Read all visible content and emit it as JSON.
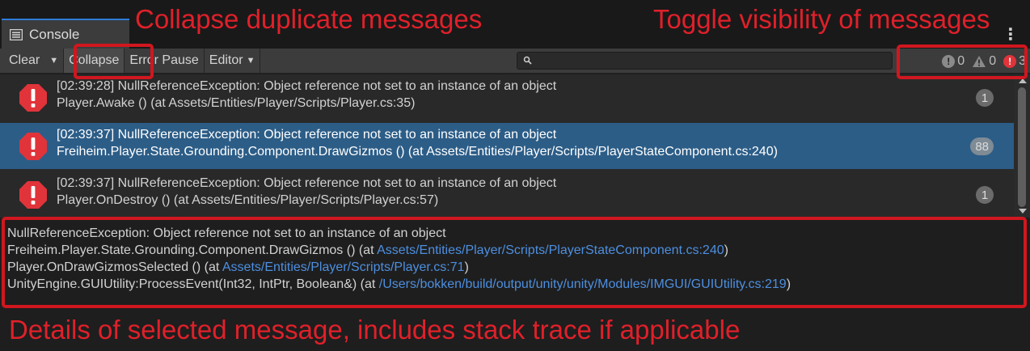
{
  "window": {
    "tab_label": "Console",
    "tab_icon": "console-list-icon",
    "menu_icon": "kebab-menu-icon",
    "accent": "#2f7cd6"
  },
  "toolbar": {
    "clear_label": "Clear",
    "collapse_label": "Collapse",
    "error_pause_label": "Error Pause",
    "editor_label": "Editor",
    "search_placeholder": "",
    "counters": {
      "info": "0",
      "warning": "0",
      "error": "3"
    }
  },
  "messages": [
    {
      "line1": "[02:39:28] NullReferenceException: Object reference not set to an instance of an object",
      "line2": "Player.Awake () (at Assets/Entities/Player/Scripts/Player.cs:35)",
      "count": "1",
      "selected": false
    },
    {
      "line1": "[02:39:37] NullReferenceException: Object reference not set to an instance of an object",
      "line2": "Freiheim.Player.State.Grounding.Component.DrawGizmos () (at Assets/Entities/Player/Scripts/PlayerStateComponent.cs:240)",
      "count": "88",
      "selected": true
    },
    {
      "line1": "[02:39:37] NullReferenceException: Object reference not set to an instance of an object",
      "line2": "Player.OnDestroy () (at Assets/Entities/Player/Scripts/Player.cs:57)",
      "count": "1",
      "selected": false
    }
  ],
  "details": {
    "line1": "NullReferenceException: Object reference not set to an instance of an object",
    "line2_prefix": "Freiheim.Player.State.Grounding.Component.DrawGizmos () (at ",
    "line2_link": "Assets/Entities/Player/Scripts/PlayerStateComponent.cs:240",
    "line2_suffix": ")",
    "line3_prefix": "Player.OnDrawGizmosSelected () (at ",
    "line3_link": "Assets/Entities/Player/Scripts/Player.cs:71",
    "line3_suffix": ")",
    "line4_prefix": "UnityEngine.GUIUtility:ProcessEvent(Int32, IntPtr, Boolean&) (at ",
    "line4_link": "/Users/bokken/build/output/unity/unity/Modules/IMGUI/GUIUtility.cs:219",
    "line4_suffix": ")"
  },
  "annotations": {
    "collapse": "Collapse duplicate messages",
    "toggle": "Toggle visibility of messages",
    "details": "Details of selected message, includes stack trace if applicable",
    "color": "#e0202a"
  }
}
